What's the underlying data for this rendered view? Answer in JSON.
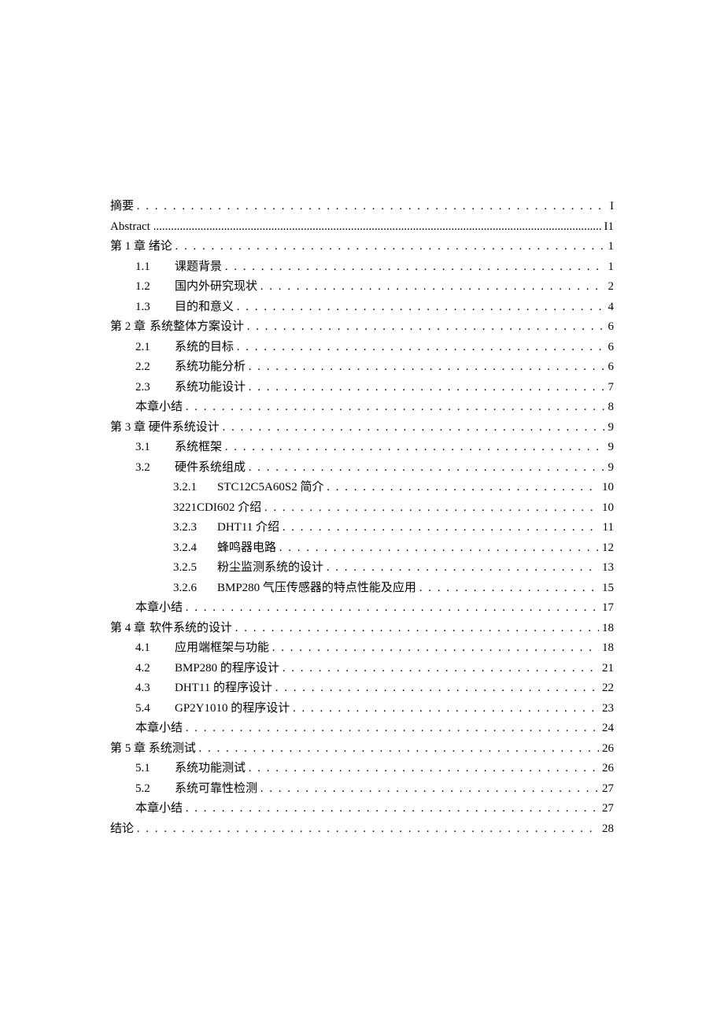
{
  "toc": [
    {
      "level": 0,
      "num": "",
      "text": "摘要",
      "page": "I",
      "leader": "dots"
    },
    {
      "level": 0,
      "num": "",
      "text": "Abstract",
      "page": "I1",
      "leader": "solid"
    },
    {
      "level": 0,
      "num": "",
      "text": "第 1 章 绪论",
      "page": "1",
      "leader": "dots"
    },
    {
      "level": 1,
      "num": "1.1",
      "text": "课题背景",
      "page": "1",
      "leader": "dots"
    },
    {
      "level": 1,
      "num": "1.2",
      "text": "国内外研究现状",
      "page": "2",
      "leader": "dots"
    },
    {
      "level": 1,
      "num": "1.3",
      "text": "目的和意义",
      "page": "4",
      "leader": "dots"
    },
    {
      "level": 0,
      "num": "第 2 章",
      "text": "系统整体方案设计",
      "page": "6",
      "leader": "dots"
    },
    {
      "level": 1,
      "num": "2.1",
      "text": "系统的目标",
      "page": "6",
      "leader": "dots"
    },
    {
      "level": 1,
      "num": "2.2",
      "text": "系统功能分析",
      "page": "6",
      "leader": "dots"
    },
    {
      "level": 1,
      "num": "2.3",
      "text": "系统功能设计",
      "page": "7",
      "leader": "dots"
    },
    {
      "level": 1,
      "num": "",
      "text": "本章小结",
      "page": "8",
      "leader": "dots"
    },
    {
      "level": 0,
      "num": "",
      "text": "第 3 章 硬件系统设计",
      "page": "9",
      "leader": "dots"
    },
    {
      "level": 1,
      "num": "3.1",
      "text": "系统框架",
      "page": "9",
      "leader": "dots"
    },
    {
      "level": 1,
      "num": "3.2",
      "text": "硬件系统组成",
      "page": "9",
      "leader": "dots"
    },
    {
      "level": 2,
      "num": "3.2.1",
      "text": "STC12C5A60S2 简介",
      "page": "10",
      "leader": "dots"
    },
    {
      "level": 2,
      "num": "",
      "text": "3221CDI602 介绍",
      "page": "10",
      "leader": "dots"
    },
    {
      "level": 2,
      "num": "3.2.3",
      "text": "DHT11 介绍",
      "page": "11",
      "leader": "dots"
    },
    {
      "level": 2,
      "num": "3.2.4",
      "text": "蜂鸣器电路",
      "page": "12",
      "leader": "dots"
    },
    {
      "level": 2,
      "num": "3.2.5",
      "text": "粉尘监测系统的设计",
      "page": "13",
      "leader": "dots"
    },
    {
      "level": 2,
      "num": "3.2.6",
      "text": "BMP280 气压传感器的特点性能及应用",
      "page": "15",
      "leader": "dots"
    },
    {
      "level": 1,
      "num": "",
      "text": "本章小结",
      "page": "17",
      "leader": "dots"
    },
    {
      "level": 0,
      "num": "第 4 章",
      "text": "软件系统的设计",
      "page": "18",
      "leader": "dots"
    },
    {
      "level": 1,
      "num": "4.1",
      "text": "应用端框架与功能",
      "page": "18",
      "leader": "dots"
    },
    {
      "level": 1,
      "num": "4.2",
      "text": "BMP280 的程序设计",
      "page": "21",
      "leader": "dots"
    },
    {
      "level": 1,
      "num": "4.3",
      "text": "DHT11 的程序设计",
      "page": "22",
      "leader": "dots"
    },
    {
      "level": 1,
      "num": "5.4",
      "text": "GP2Y1010 的程序设计",
      "page": "23",
      "leader": "dots"
    },
    {
      "level": 1,
      "num": "",
      "text": "本章小结",
      "page": "24",
      "leader": "dots"
    },
    {
      "level": 0,
      "num": "",
      "text": "第 5 章 系统测试",
      "page": "26",
      "leader": "dots"
    },
    {
      "level": 1,
      "num": "5.1",
      "text": "系统功能测试",
      "page": "26",
      "leader": "dots"
    },
    {
      "level": 1,
      "num": "5.2",
      "text": "系统可靠性检测",
      "page": "27",
      "leader": "dots"
    },
    {
      "level": 1,
      "num": "",
      "text": "本章小结",
      "page": "27",
      "leader": "dots"
    },
    {
      "level": 0,
      "num": "",
      "text": "结论",
      "page": "28",
      "leader": "dots"
    }
  ]
}
